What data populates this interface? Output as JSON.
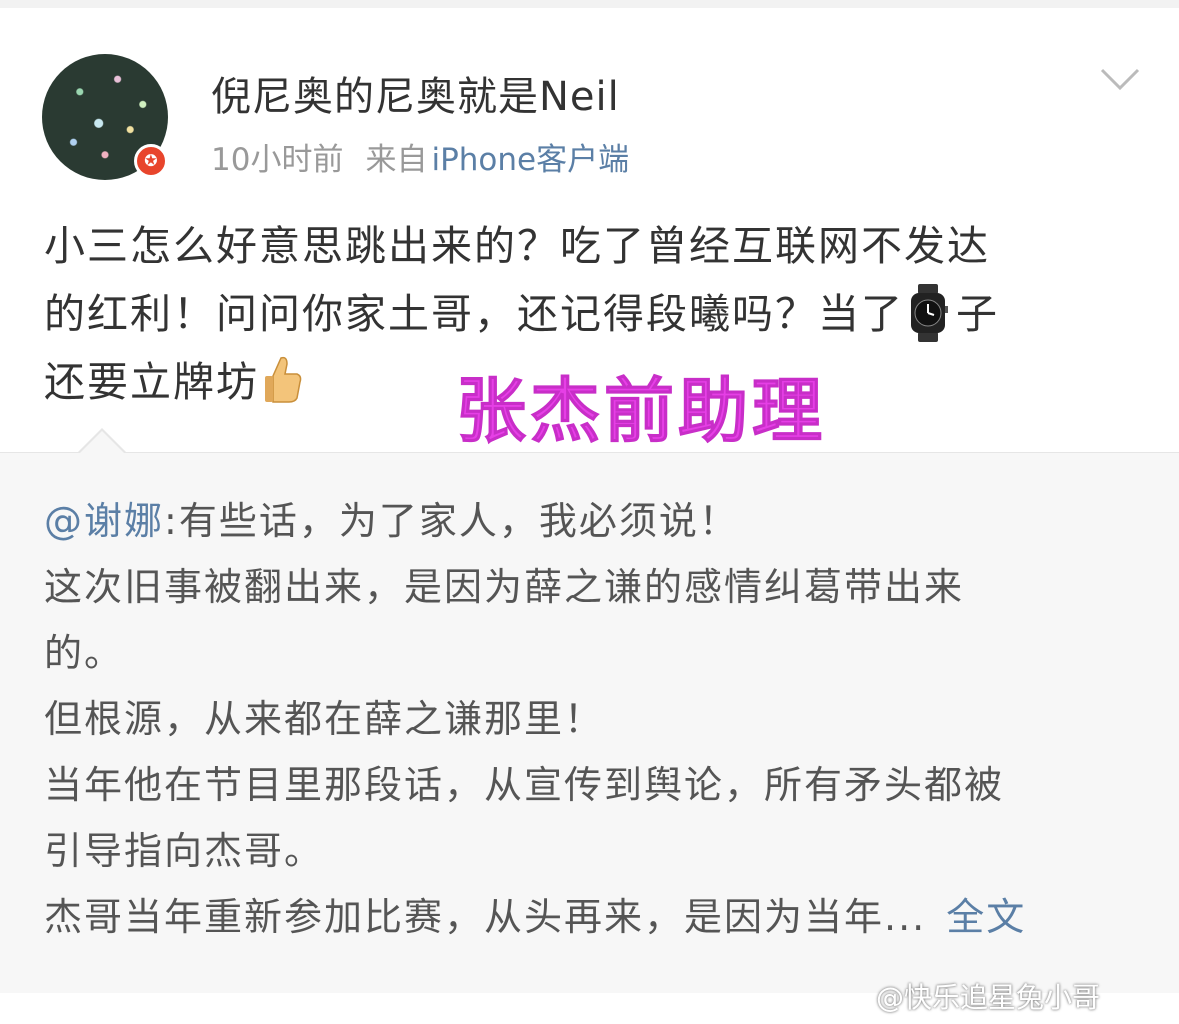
{
  "post": {
    "username": "倪尼奥的尼奥就是Neil",
    "time": "10小时前",
    "source_prefix": "来自",
    "source": "iPhone客户端",
    "text_lines": [
      "小三怎么好意思跳出来的？吃了曾经互联网不发达",
      "的红利！问问你家土哥，还记得段曦吗？当了",
      "子",
      "还要立牌坊"
    ],
    "emoji_watch": "watch-emoji",
    "emoji_thumb": "thumbs-up-emoji"
  },
  "overlay_tag": "张杰前助理",
  "repost": {
    "mention": "@谢娜",
    "lines": [
      ":有些话，为了家人，我必须说！",
      "这次旧事被翻出来，是因为薛之谦的感情纠葛带出来",
      "的。",
      "但根源，从来都在薛之谦那里！",
      "当年他在节目里那段话，从宣传到舆论，所有矛头都被",
      "引导指向杰哥。",
      "杰哥当年重新参加比赛，从头再来，是因为当年..."
    ],
    "more_label": "全文"
  },
  "watermark": "@快乐追星兔小哥",
  "colors": {
    "link": "#5b7fa6",
    "badge": "#e8452c",
    "overlay": "#e63fe6"
  }
}
